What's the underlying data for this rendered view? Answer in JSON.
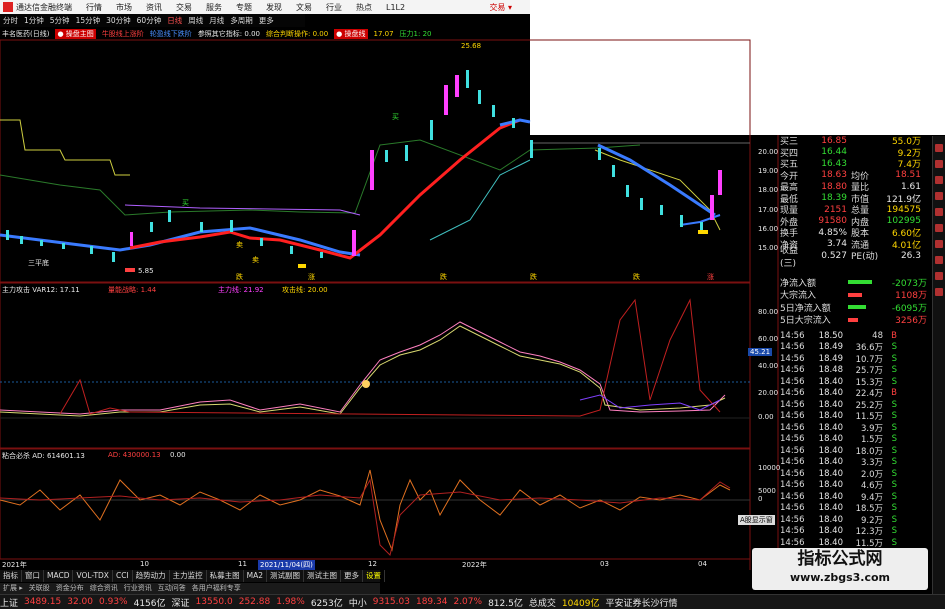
{
  "titlebar": {
    "app": "通达信金融终端",
    "menus": [
      "行情",
      "市场",
      "资讯",
      "交易",
      "服务",
      "专题",
      "发现",
      "文易",
      "行业",
      "热点",
      "L1L2"
    ],
    "trade": "交易 ▾"
  },
  "toolbar": {
    "items": [
      "分时",
      "1分钟",
      "5分钟",
      "15分钟",
      "30分钟",
      "60分钟",
      "日线",
      "周线",
      "月线",
      "多周期",
      "更多"
    ],
    "active": "日线"
  },
  "main_legend": {
    "stock": "丰名医药(日线)",
    "i1": "● 操盘主图",
    "i2": "牛股线上涨阶",
    "i3": "轮盈线下跌阶",
    "i4": "参照其它指标: 0.00",
    "i5": "综合判断操作: 0.00",
    "i6": "● 操盘线",
    "i7": "17.07",
    "i8": "压力1: 20"
  },
  "price_labels": {
    "high": "25.68",
    "low": "5.85",
    "axis": [
      "20.00",
      "19.00",
      "18.00",
      "17.00",
      "16.00",
      "15.00"
    ]
  },
  "chart_marks": {
    "buy1": "买",
    "buy2": "买",
    "sell1": "卖",
    "sell2": "卖",
    "b3": "三平底",
    "k1": "跌",
    "k2": "涨",
    "k3": "跌",
    "k4": "跌",
    "k5": "跌",
    "k6": "涨"
  },
  "quote": {
    "rows": [
      [
        "买三",
        "16.85",
        "",
        "55.0万"
      ],
      [
        "买四",
        "16.44",
        "",
        "9.2万"
      ],
      [
        "买五",
        "16.43",
        "",
        "7.4万"
      ],
      [
        "今开",
        "18.63",
        "均价",
        "18.51"
      ],
      [
        "最高",
        "18.80",
        "量比",
        "1.61"
      ],
      [
        "最低",
        "18.39",
        "市值",
        "121.9亿"
      ],
      [
        "现量",
        "2151",
        "总量",
        "194575"
      ],
      [
        "外盘",
        "91580",
        "内盘",
        "102995"
      ],
      [
        "换手",
        "4.85%",
        "股本",
        "6.60亿"
      ],
      [
        "净资",
        "3.74",
        "流通",
        "4.01亿"
      ],
      [
        "收益(三)",
        "0.527",
        "PE(动)",
        "26.3"
      ]
    ]
  },
  "flow": {
    "rows": [
      [
        "净流入额",
        "-2073万"
      ],
      [
        "大宗流入",
        "1108万"
      ],
      [
        "5日净流入额",
        "-6095万"
      ],
      [
        "5日大宗流入",
        "3256万"
      ]
    ]
  },
  "ticks": [
    [
      "14:56",
      "18.50",
      "48",
      "B"
    ],
    [
      "14:56",
      "18.49",
      "36.6万",
      "S"
    ],
    [
      "14:56",
      "18.49",
      "10.7万",
      "S"
    ],
    [
      "14:56",
      "18.48",
      "25.7万",
      "S"
    ],
    [
      "14:56",
      "18.40",
      "15.3万",
      "S"
    ],
    [
      "14:56",
      "18.40",
      "22.4万",
      "B"
    ],
    [
      "14:56",
      "18.40",
      "25.2万",
      "S"
    ],
    [
      "14:56",
      "18.40",
      "11.5万",
      "S"
    ],
    [
      "14:56",
      "18.40",
      "3.9万",
      "S"
    ],
    [
      "14:56",
      "18.40",
      "1.5万",
      "S"
    ],
    [
      "14:56",
      "18.40",
      "18.0万",
      "S"
    ],
    [
      "14:56",
      "18.40",
      "3.3万",
      "S"
    ],
    [
      "14:56",
      "18.40",
      "2.0万",
      "S"
    ],
    [
      "14:56",
      "18.40",
      "4.6万",
      "S"
    ],
    [
      "14:56",
      "18.40",
      "9.4万",
      "S"
    ],
    [
      "14:56",
      "18.40",
      "18.5万",
      "S"
    ],
    [
      "14:56",
      "18.40",
      "9.2万",
      "S"
    ],
    [
      "14:56",
      "18.40",
      "12.3万",
      "S"
    ],
    [
      "14:56",
      "18.40",
      "11.5万",
      "S"
    ]
  ],
  "ind1": {
    "title": "主力攻击 VAR12: 17.11",
    "v2": "量能战略: 1.44",
    "v3": "主力线: 21.92",
    "v4": "攻击线: 20.00",
    "axis": [
      "80.00",
      "60.00",
      "40.00",
      "20.00",
      "0.00"
    ],
    "marker": "45.21"
  },
  "ind2": {
    "title": "粘合必杀 AD: 614601.13",
    "v2": "AD: 430000.13",
    "v3": "0.00",
    "axis": [
      "10000",
      "5000",
      "0"
    ],
    "popup": "A股显示窗"
  },
  "date_axis": [
    "2021年",
    "10",
    "11",
    "2021/11/04(四)",
    "12",
    "2022年",
    "03",
    "04"
  ],
  "tabs": [
    "指标",
    "窗口",
    "MACD",
    "VOL-TDX",
    "CCI",
    "趋势动力",
    "主力监控",
    "私募主图",
    "MA2",
    "测试副图",
    "测试主图",
    "更多",
    "设置"
  ],
  "tabs2": [
    "扩展 ▸",
    "关联股",
    "资金分布",
    "综合资讯",
    "行业资讯",
    "互动问答",
    "各用户福利专享"
  ],
  "status": {
    "i1": "上证",
    "v1": "3489.15",
    "c1": "32.00",
    "p1": "0.93%",
    "a1": "4156亿",
    "i2": "深证",
    "v2": "13550.0",
    "c2": "252.88",
    "p2": "1.98%",
    "a2": "6253亿",
    "i3": "中小",
    "v3": "9315.03",
    "c3": "189.34",
    "p3": "2.07%",
    "a3": "812.5亿",
    "i4": "总成交",
    "v4": "10409亿",
    "n": "平安证券长沙行情"
  },
  "watermark": {
    "a": "指标公式网",
    "b": "www.zbgs3.com"
  },
  "colors": {
    "up": "#ff4040",
    "down": "#33dd33",
    "candle_up": "#ff40ff",
    "candle_dn": "#40e0e0",
    "ma_red": "#ff2020",
    "ma_blue": "#3a7bff"
  }
}
